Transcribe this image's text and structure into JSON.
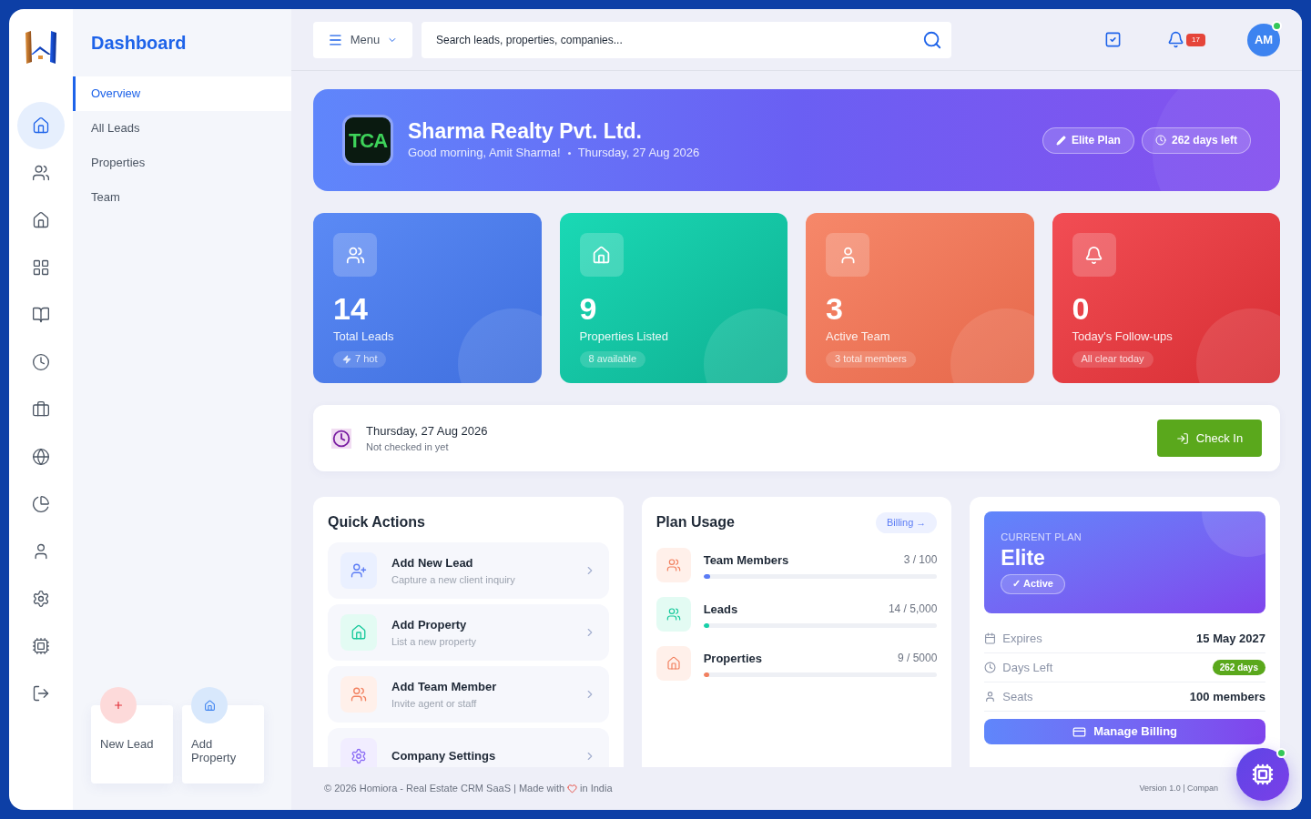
{
  "rail": [
    {
      "selected": true
    },
    {
      "selected": false
    },
    {
      "selected": false
    },
    {
      "selected": false
    },
    {
      "selected": false
    },
    {
      "selected": false
    },
    {
      "selected": false
    },
    {
      "selected": false
    },
    {
      "selected": false
    },
    {
      "selected": false
    },
    {
      "selected": false
    },
    {
      "selected": false
    },
    {
      "selected": false
    }
  ],
  "submenu": {
    "title": "Dashboard",
    "items": [
      {
        "label": "Overview",
        "selected": true
      },
      {
        "label": "All Leads",
        "selected": false
      },
      {
        "label": "Properties",
        "selected": false
      },
      {
        "label": "Team",
        "selected": false
      }
    ],
    "shortcuts": [
      {
        "kind": "lead",
        "label": "New Lead"
      },
      {
        "kind": "property",
        "label": "Add Property"
      }
    ]
  },
  "topbar": {
    "menu": "Menu",
    "search": {
      "placeholder": "Search leads, properties, companies..."
    },
    "notifications": "17",
    "avatar": "AM",
    "online": true
  },
  "hero": {
    "logo": "TCA",
    "company": "Sharma Realty Pvt. Ltd.",
    "greeting": "Good morning, Amit Sharma!",
    "date": "Thursday, 27 Aug 2026",
    "badges": [
      {
        "kind": "plan",
        "label": "Elite Plan"
      },
      {
        "kind": "days",
        "label": "262 days left"
      }
    ]
  },
  "stats": [
    {
      "kind": "leads",
      "value": "14",
      "label": "Total Leads",
      "tag": "7 hot",
      "hot": true
    },
    {
      "kind": "properties",
      "value": "9",
      "label": "Properties Listed",
      "tag": "8 available",
      "hot": false
    },
    {
      "kind": "team",
      "value": "3",
      "label": "Active Team",
      "tag": "3 total members",
      "hot": false
    },
    {
      "kind": "followups",
      "value": "0",
      "label": "Today's Follow-ups",
      "tag": "All clear today",
      "hot": false
    }
  ],
  "checkin": {
    "date": "Thursday, 27 Aug 2026",
    "status": "Not checked in yet",
    "button": "Check In"
  },
  "quick_actions": {
    "title": "Quick Actions",
    "items": [
      {
        "kind": "lead",
        "title": "Add New Lead",
        "subtitle": "Capture a new client inquiry"
      },
      {
        "kind": "property",
        "title": "Add Property",
        "subtitle": "List a new property"
      },
      {
        "kind": "team",
        "title": "Add Team Member",
        "subtitle": "Invite agent or staff"
      },
      {
        "kind": "settings",
        "title": "Company Settings"
      }
    ]
  },
  "plan_usage": {
    "title": "Plan Usage",
    "link": "Billing →",
    "items": [
      {
        "kind": "team",
        "label": "Team Members",
        "reading": "3 / 100",
        "level": 0.03
      },
      {
        "kind": "leads",
        "label": "Leads",
        "reading": "14 / 5,000",
        "level": 0.003
      },
      {
        "kind": "properties",
        "label": "Properties",
        "reading": "9 / 5000",
        "level": 0.002
      }
    ]
  },
  "plan": {
    "caption": "CURRENT PLAN",
    "name": "Elite",
    "status": "✓ Active",
    "rows": [
      {
        "kind": "expires",
        "label": "Expires",
        "value": "15 May 2027",
        "badge": false
      },
      {
        "kind": "days",
        "label": "Days Left",
        "value": "262 days",
        "badge": true
      },
      {
        "kind": "seats",
        "label": "Seats",
        "value": "100 members",
        "badge": false
      }
    ],
    "button": "Manage Billing"
  },
  "footer": {
    "left": "© 2026 Homiora - Real Estate CRM SaaS | Made with",
    "left_end": "in India",
    "right": "Version 1.0 | Compan"
  },
  "fab": {
    "online": true
  }
}
